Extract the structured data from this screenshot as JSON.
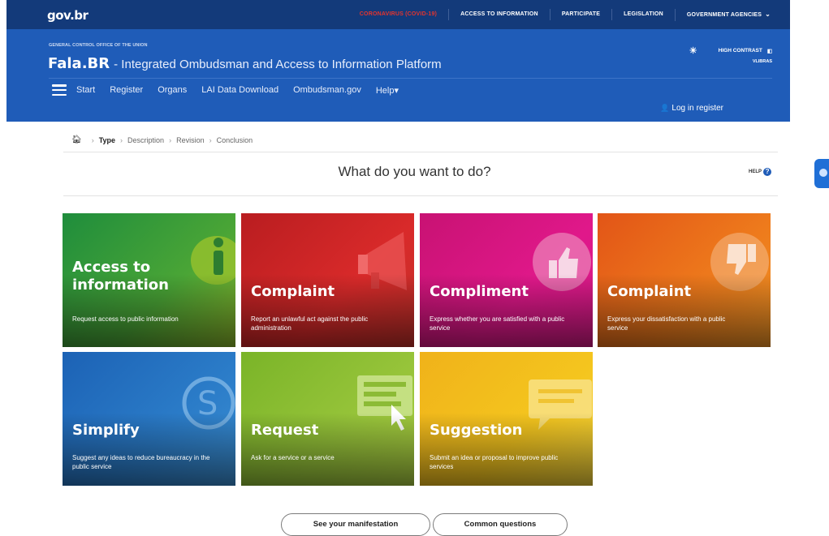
{
  "govbar": {
    "logo": "gov.br",
    "links": [
      "CORONAVIRUS (COVID-19)",
      "ACCESS TO INFORMATION",
      "PARTICIPATE",
      "LEGISLATION",
      "GOVERNMENT AGENCIES"
    ]
  },
  "header": {
    "org": "GENERAL CONTROL OFFICE OF THE UNION",
    "brand": "Fala.BR",
    "subtitle": "- Integrated Ombudsman and Access to Information Platform",
    "contrast": "HIGH CONTRAST",
    "vlibras": "VLIBRAS",
    "nav": [
      "Start",
      "Register",
      "Organs",
      "LAI Data Download",
      "Ombudsman.gov",
      "Help"
    ],
    "login": "Log in",
    "register": "register"
  },
  "breadcrumb": [
    "Type",
    "Description",
    "Revision",
    "Conclusion"
  ],
  "question": "What do you want to do?",
  "help": "HELP",
  "cards": [
    {
      "title": "Access to information",
      "title_l1": "Access to",
      "title_l2": "information",
      "desc": "Request access to public information"
    },
    {
      "title": "Complaint",
      "desc": "Report an unlawful act against the public administration"
    },
    {
      "title": "Compliment",
      "desc": "Express whether you are satisfied with a public service"
    },
    {
      "title": "Complaint",
      "desc": "Express your dissatisfaction with a public service"
    },
    {
      "title": "Simplify",
      "desc": "Suggest any ideas to reduce bureaucracy in the public service"
    },
    {
      "title": "Request",
      "desc": "Ask for a service or a service"
    },
    {
      "title": "Suggestion",
      "desc": "Submit an idea or proposal to improve public services"
    }
  ],
  "buttons": {
    "manifestation": "See your manifestation",
    "questions": "Common questions"
  }
}
